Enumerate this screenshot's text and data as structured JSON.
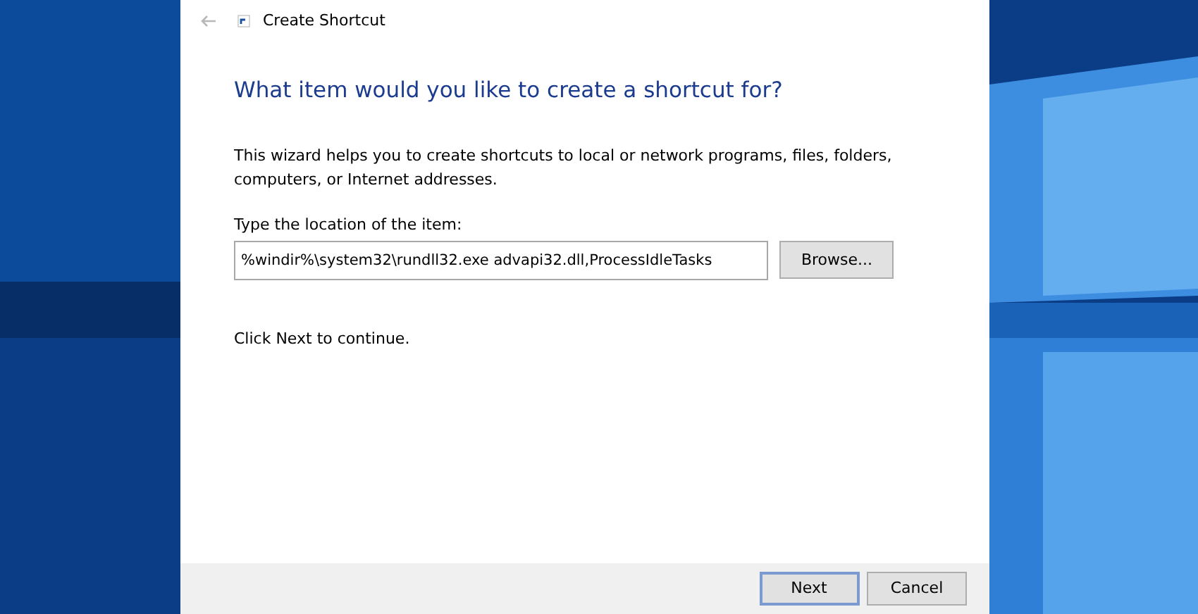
{
  "window": {
    "title": "Create Shortcut",
    "back_disabled": true
  },
  "heading": "What item would you like to create a shortcut for?",
  "description": "This wizard helps you to create shortcuts to local or network programs, files, folders, computers, or Internet addresses.",
  "location": {
    "label": "Type the location of the item:",
    "value": "%windir%\\system32\\rundll32.exe advapi32.dll,ProcessIdleTasks",
    "browse": "Browse..."
  },
  "hint": "Click Next to continue.",
  "buttons": [
    {
      "label": "Next",
      "default": true
    },
    {
      "label": "Cancel",
      "default": false
    }
  ]
}
